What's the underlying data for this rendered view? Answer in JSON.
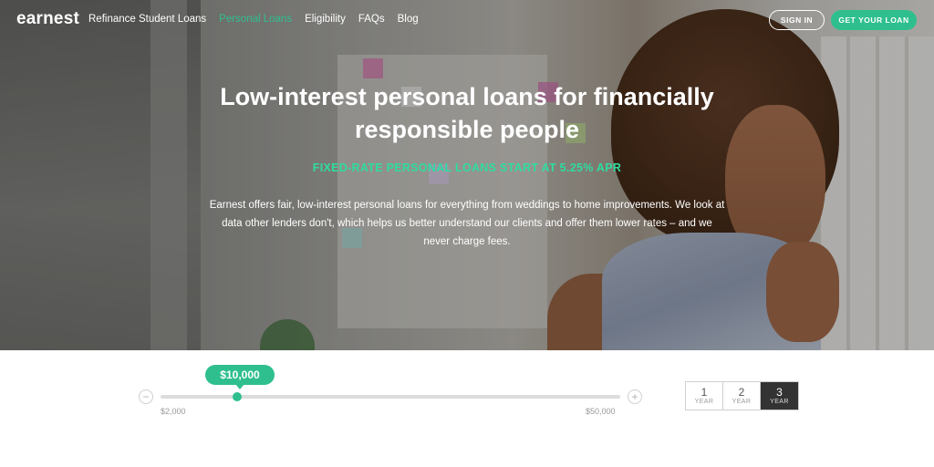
{
  "nav": {
    "logo": "earnest",
    "links": [
      {
        "label": "Refinance Student Loans",
        "active": false
      },
      {
        "label": "Personal Loans",
        "active": true
      },
      {
        "label": "Eligibility",
        "active": false
      },
      {
        "label": "FAQs",
        "active": false
      },
      {
        "label": "Blog",
        "active": false
      }
    ],
    "sign_in": "SIGN IN",
    "get_loan": "GET YOUR LOAN"
  },
  "hero": {
    "title_line1": "Low-interest personal loans for financially",
    "title_line2": "responsible people",
    "subtitle": "FIXED-RATE PERSONAL LOANS START AT 5.25% APR",
    "description": "Earnest offers fair, low-interest personal loans for everything from weddings to home improvements. We look at data other lenders don't, which helps us better understand our clients and offer them lower rates – and we never charge fees."
  },
  "loan_slider": {
    "amount": "$10,000",
    "min_label": "$2,000",
    "max_label": "$50,000",
    "min_value": 2000,
    "max_value": 50000,
    "value": 10000,
    "decrement_icon": "minus-icon",
    "increment_icon": "plus-icon"
  },
  "terms": [
    {
      "num": "1",
      "unit": "YEAR",
      "selected": false
    },
    {
      "num": "2",
      "unit": "YEAR",
      "selected": false
    },
    {
      "num": "3",
      "unit": "YEAR",
      "selected": true
    }
  ],
  "colors": {
    "accent": "#2fbf8f",
    "subtitle_green": "#2fdca0",
    "selected_term": "#333333"
  }
}
